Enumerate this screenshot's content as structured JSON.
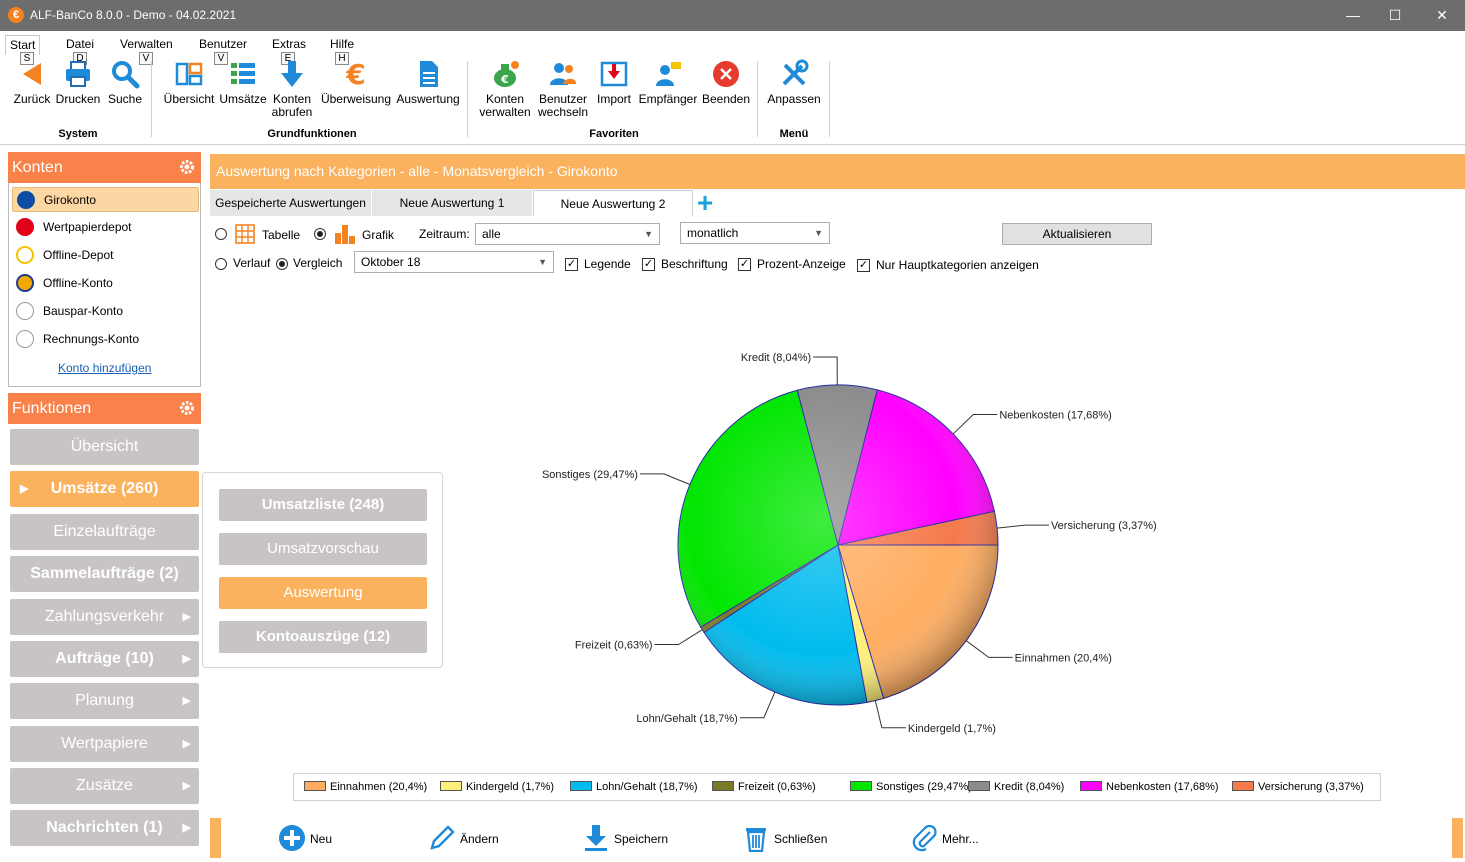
{
  "window": {
    "title": "ALF-BanCo 8.0.0 - Demo  -  04.02.2021",
    "app_icon": "€",
    "controls": [
      "minimize-icon",
      "maximize-icon",
      "close-icon"
    ]
  },
  "ribbon": {
    "tabs": [
      {
        "label": "Start",
        "key": "S"
      },
      {
        "label": "Datei",
        "key": "D"
      },
      {
        "label": "Verwalten",
        "key": "V"
      },
      {
        "label": "Benutzer",
        "key": "V"
      },
      {
        "label": "Extras",
        "key": "E"
      },
      {
        "label": "Hilfe",
        "key": "H"
      }
    ],
    "buttons": {
      "zurueck": "Zurück",
      "drucken": "Drucken",
      "suche": "Suche",
      "uebersicht": "Übersicht",
      "umsaetze": "Umsätze",
      "konten_abrufen_1": "Konten",
      "konten_abrufen_2": "abrufen",
      "ueberweisung": "Überweisung",
      "auswertung": "Auswertung",
      "konten_verwalten_1": "Konten",
      "konten_verwalten_2": "verwalten",
      "benutzer_wechseln_1": "Benutzer",
      "benutzer_wechseln_2": "wechseln",
      "import": "Import",
      "empfaenger": "Empfänger",
      "beenden": "Beenden",
      "anpassen": "Anpassen"
    },
    "groups": {
      "system": "System",
      "grundfunktionen": "Grundfunktionen",
      "favoriten": "Favoriten",
      "menue": "Menü"
    }
  },
  "konten": {
    "title": "Konten",
    "items": [
      {
        "label": "Girokonto",
        "icon": "volksbank-icon",
        "color": "#0a4da2"
      },
      {
        "label": "Wertpapierdepot",
        "icon": "sparkasse-icon",
        "color": "#e2001a"
      },
      {
        "label": "Offline-Depot",
        "icon": "commerzbank-icon",
        "color": "#f5c400"
      },
      {
        "label": "Offline-Konto",
        "icon": "postbank-icon",
        "color": "#f5a800"
      },
      {
        "label": "Bauspar-Konto",
        "icon": "bank-building-icon",
        "color": "#9a9a9a"
      },
      {
        "label": "Rechnungs-Konto",
        "icon": "bank-building-icon",
        "color": "#9a9a9a"
      }
    ],
    "add_link": "Konto hinzufügen"
  },
  "funktionen": {
    "title": "Funktionen",
    "items": [
      {
        "label": "Übersicht",
        "bold": false,
        "arrow": false
      },
      {
        "label": "Umsätze (260)",
        "bold": true,
        "arrow": false,
        "active": true
      },
      {
        "label": "Einzelaufträge",
        "bold": false,
        "arrow": false
      },
      {
        "label": "Sammelaufträge (2)",
        "bold": true,
        "arrow": false
      },
      {
        "label": "Zahlungsverkehr",
        "bold": false,
        "arrow": true
      },
      {
        "label": "Aufträge (10)",
        "bold": true,
        "arrow": true
      },
      {
        "label": "Planung",
        "bold": false,
        "arrow": true
      },
      {
        "label": "Wertpapiere",
        "bold": false,
        "arrow": true
      },
      {
        "label": "Zusätze",
        "bold": false,
        "arrow": true
      },
      {
        "label": "Nachrichten (1)",
        "bold": true,
        "arrow": true
      }
    ],
    "flyout": [
      {
        "label": "Umsatzliste (248)",
        "bold": true
      },
      {
        "label": "Umsatzvorschau",
        "bold": false
      },
      {
        "label": "Auswertung",
        "bold": false,
        "active": true
      },
      {
        "label": "Kontoauszüge (12)",
        "bold": true
      }
    ]
  },
  "main": {
    "header": "Auswertung nach Kategorien - alle - Monatsvergleich - Girokonto",
    "tabs": [
      {
        "label": "Gespeicherte Auswertungen"
      },
      {
        "label": "Neue Auswertung 1"
      },
      {
        "label": "Neue Auswertung 2",
        "active": true
      }
    ],
    "options": {
      "tabelle": "Tabelle",
      "grafik": "Grafik",
      "zeitraum_label": "Zeitraum:",
      "zeitraum_value": "alle",
      "intervall_value": "monatlich",
      "aktualisieren": "Aktualisieren",
      "verlauf": "Verlauf",
      "vergleich": "Vergleich",
      "monat_value": "Oktober 18",
      "legende": "Legende",
      "beschriftung": "Beschriftung",
      "prozent": "Prozent-Anzeige",
      "hauptkategorien": "Nur Hauptkategorien anzeigen"
    }
  },
  "chart_data": {
    "type": "pie",
    "categories": [
      "Einnahmen",
      "Kindergeld",
      "Lohn/Gehalt",
      "Freizeit",
      "Sonstiges",
      "Kredit",
      "Nebenkosten",
      "Versicherung"
    ],
    "values": [
      20.4,
      1.7,
      18.7,
      0.63,
      29.47,
      8.04,
      17.68,
      3.37
    ],
    "slice_labels": [
      "Einnahmen (20,4%)",
      "Kindergeld (1,7%)",
      "Lohn/Gehalt (18,7%)",
      "Freizeit (0,63%)",
      "Sonstiges (29,47%)",
      "Kredit (8,04%)",
      "Nebenkosten (17,68%)",
      "Versicherung (3,37%)"
    ],
    "colors": [
      "#ffad60",
      "#fff07a",
      "#00bbee",
      "#7a7a2a",
      "#00e600",
      "#8c8c8c",
      "#ff00ff",
      "#f47a4c"
    ],
    "legend": "bottom",
    "start": "right",
    "direction": "clockwise"
  },
  "bottom": {
    "neu": "Neu",
    "aendern": "Ändern",
    "speichern": "Speichern",
    "schliessen": "Schließen",
    "mehr": "Mehr..."
  }
}
